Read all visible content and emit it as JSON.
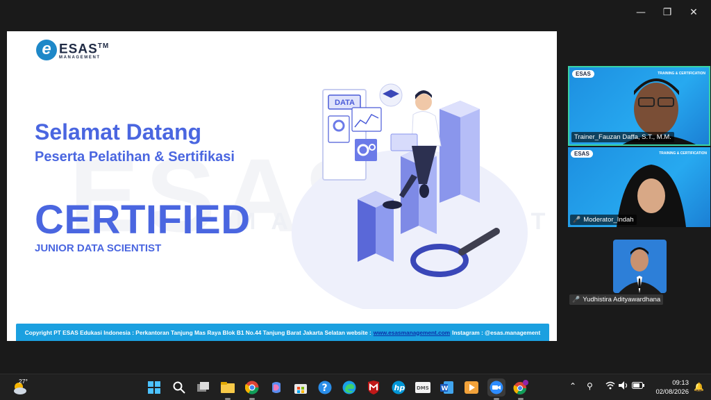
{
  "window": {
    "minimize_glyph": "—",
    "restore_glyph": "❐",
    "close_glyph": "✕"
  },
  "slide": {
    "watermark_main": "ESAS",
    "watermark_sub": "MANAGEMENT",
    "logo_letter": "e",
    "logo_name": "ESAS",
    "logo_tm": "TM",
    "logo_sub": "MANAGEMENT",
    "welcome": "Selamat Datang",
    "subtitle": "Peserta Pelatihan & Sertifikasi",
    "certified": "CERTIFIED",
    "role": "JUNIOR DATA SCIENTIST",
    "illustration_label": "DATA",
    "footer_prefix": "Copyright PT ESAS Edukasi Indonesia : Perkantoran Tanjung Mas Raya Blok B1 No.44 Tanjung Barat Jakarta Selatan website :",
    "footer_link": "www.esasmanagement.com",
    "footer_suffix": "Instagram : @esas.management"
  },
  "participants": [
    {
      "name": "Trainer_Fauzan Daffa, S.T., M.M.",
      "logo": "ESAS",
      "corner": "TRAINING & CERTIFICATION",
      "muted": false,
      "active": true
    },
    {
      "name": "Moderator_Indah",
      "logo": "ESAS",
      "corner": "TRAINING & CERTIFICATION",
      "muted": true,
      "active": false
    },
    {
      "name": "Yudhistira Adityawardhana",
      "muted": true,
      "active": false
    }
  ],
  "taskbar": {
    "weather_temp": "27°",
    "apps": [
      "start",
      "search",
      "task-view",
      "file-explorer",
      "chrome",
      "copilot",
      "store",
      "help",
      "edge",
      "mcafee",
      "hp",
      "dms",
      "word",
      "media-player",
      "zoom",
      "chrome-profile"
    ],
    "time": "09:13",
    "date": "02/08/2026"
  },
  "colors": {
    "accent": "#4a66e0",
    "footer": "#1ba0e0",
    "active_speaker": "#3ad3a6",
    "taskbar": "#202020"
  }
}
